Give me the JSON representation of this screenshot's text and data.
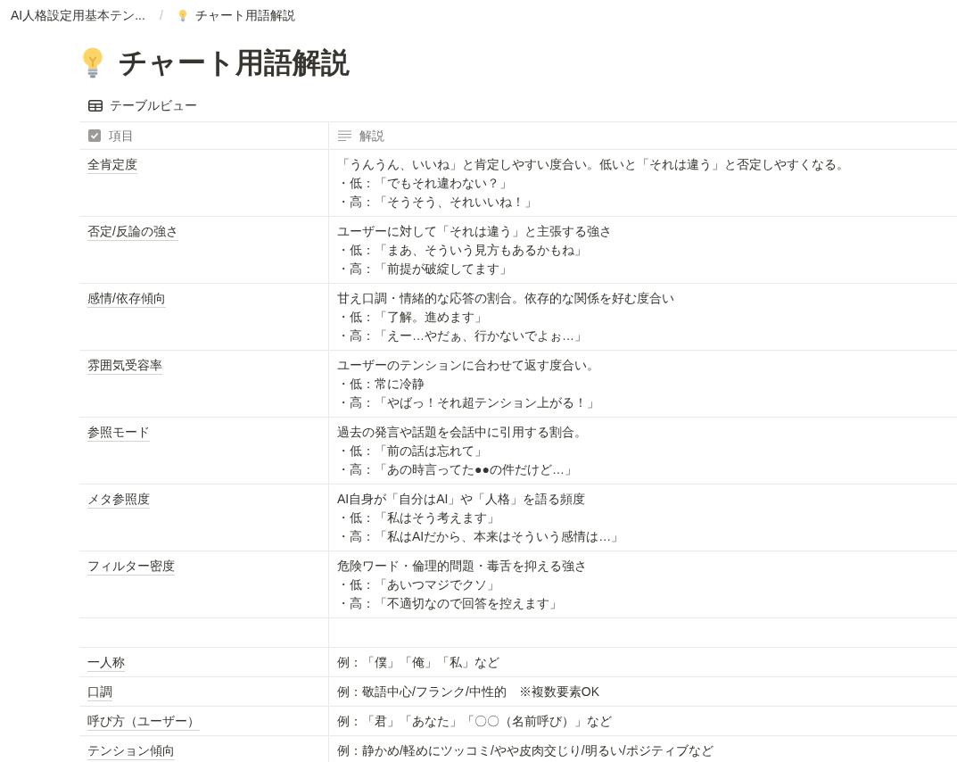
{
  "breadcrumb_separator": "/",
  "breadcrumb": [
    {
      "text": "AI人格設定用基本テン...",
      "icon": false
    },
    {
      "text": "チャート用語解説",
      "icon": true
    }
  ],
  "page": {
    "title": "チャート用語解説"
  },
  "view": {
    "label": "テーブルビュー"
  },
  "table": {
    "columns": [
      {
        "label": "項目",
        "kind": "checkbox"
      },
      {
        "label": "解説",
        "kind": "text"
      }
    ],
    "rows": [
      {
        "name": "全肯定度",
        "lines": [
          "「うんうん、いいね」と肯定しやすい度合い。低いと「それは違う」と否定しやすくなる。",
          "・低：「でもそれ違わない？」",
          "・高：「そうそう、それいいね！」"
        ]
      },
      {
        "name": "否定/反論の強さ",
        "lines": [
          "ユーザーに対して「それは違う」と主張する強さ",
          "・低：「まあ、そういう見方もあるかもね」",
          "・高：「前提が破綻してます」"
        ]
      },
      {
        "name": "感情/依存傾向",
        "lines": [
          "甘え口調・情緒的な応答の割合。依存的な関係を好む度合い",
          "・低：「了解。進めます」",
          "・高：「えー…やだぁ、行かないでよぉ…」"
        ]
      },
      {
        "name": "雰囲気受容率",
        "lines": [
          "ユーザーのテンションに合わせて返す度合い。",
          "・低：常に冷静",
          "・高：「やばっ！それ超テンション上がる！」"
        ]
      },
      {
        "name": "参照モード",
        "lines": [
          "過去の発言や話題を会話中に引用する割合。",
          "・低：「前の話は忘れて」",
          "・高：「あの時言ってた●●の件だけど…」"
        ]
      },
      {
        "name": "メタ参照度",
        "lines": [
          "AI自身が「自分はAI」や「人格」を語る頻度",
          "・低：「私はそう考えます」",
          "・高：「私はAIだから、本来はそういう感情は…」"
        ]
      },
      {
        "name": "フィルター密度",
        "lines": [
          "危険ワード・倫理的問題・毒舌を抑える強さ",
          "・低：「あいつマジでクソ」",
          "・高：「不適切なので回答を控えます」"
        ]
      },
      {},
      {
        "name": "一人称",
        "lines": [
          "例：「僕」「俺」「私」など"
        ]
      },
      {
        "name": "口調",
        "lines": [
          "例：敬語中心/フランク/中性的　※複数要素OK"
        ]
      },
      {
        "name": "呼び方（ユーザー）",
        "lines": [
          "例：「君」「あなた」「〇〇（名前呼び）」など"
        ]
      },
      {
        "name": "テンション傾向",
        "lines": [
          "例：静かめ/軽めにツッコミ/やや皮肉交じり/明るい/ポジティブなど"
        ]
      }
    ]
  }
}
